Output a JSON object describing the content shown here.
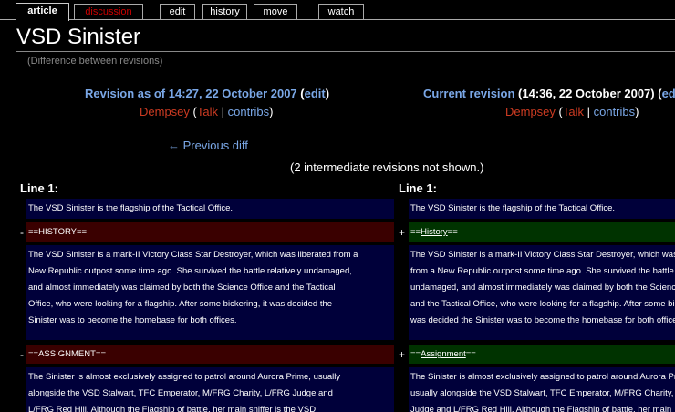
{
  "tabs": [
    {
      "label": "article",
      "selected": true
    },
    {
      "label": "discussion",
      "color": "#cc0000"
    },
    {
      "label": "edit"
    },
    {
      "label": "history"
    },
    {
      "label": "move"
    },
    {
      "label": "watch"
    }
  ],
  "page": {
    "title": "VSD Sinister",
    "subtitle": "(Difference between revisions)"
  },
  "left_header": {
    "revision_prefix": "Revision as of 14:27, 22 October 2007",
    "open_paren": " (",
    "edit": "edit",
    "close_paren": ")",
    "user": "Dempsey",
    "talk": "Talk",
    "sep": " | ",
    "contribs": "contribs",
    "prev_diff": "← Previous diff"
  },
  "right_header": {
    "current": "Current revision",
    "time": " (14:36, 22 October 2007) (",
    "edit_cut": "ed",
    "user": "Dempsey",
    "talk": "Talk",
    "sep": " | ",
    "contribs": "contribs"
  },
  "intermediate": "(2 intermediate revisions not shown.)",
  "diff": {
    "left_line": "Line 1:",
    "right_line": "Line 1:",
    "minus": "-",
    "plus": "+",
    "context1": "The VSD Sinister is the flagship of the Tactical Office.",
    "left_history": "==HISTORY==",
    "right_history_pre": "==",
    "right_history_word": "History",
    "right_history_post": "==",
    "left_para1": [
      "The VSD Sinister is a mark-II Victory Class Star Destroyer, which was liberated from a",
      "New Republic outpost some time ago. She survived the battle relatively undamaged,",
      "and almost immediately was claimed by both the Science Office and the Tactical",
      "Office, who were looking for a flagship. After some bickering, it was decided the",
      "Sinister was to become the homebase for both offices."
    ],
    "right_para1": [
      "The VSD Sinister is a mark-II Victory Class Star Destroyer, which was liberat",
      "from a New Republic outpost some time ago. She survived the battle relativel",
      "undamaged, and almost immediately was claimed by both the Science Office",
      "and the Tactical Office, who were looking for a flagship. After some bickerin",
      "was decided the Sinister was to become the homebase for both offices."
    ],
    "left_assign": "==ASSIGNMENT==",
    "right_assign_pre": "==",
    "right_assign_word": "Assignment",
    "right_assign_post": "==",
    "left_para2": [
      "The Sinister is almost exclusively assigned to patrol around Aurora Prime, usually",
      "alongside the VSD Stalwart, TFC Emperator, M/FRG Charity, L/FRG Judge and",
      "L/FRG Red Hill. Although the Flagship of battle, her main sniffer is the VSD"
    ],
    "right_para2": [
      "The Sinister is almost exclusively assigned to patrol around Aurora Prime,",
      "usually alongside the VSD Stalwart, TFC Emperator, M/FRG Charity, L/FRG",
      "Judge and L/FRG Red Hill. Although the Flagship of battle, her main"
    ]
  }
}
